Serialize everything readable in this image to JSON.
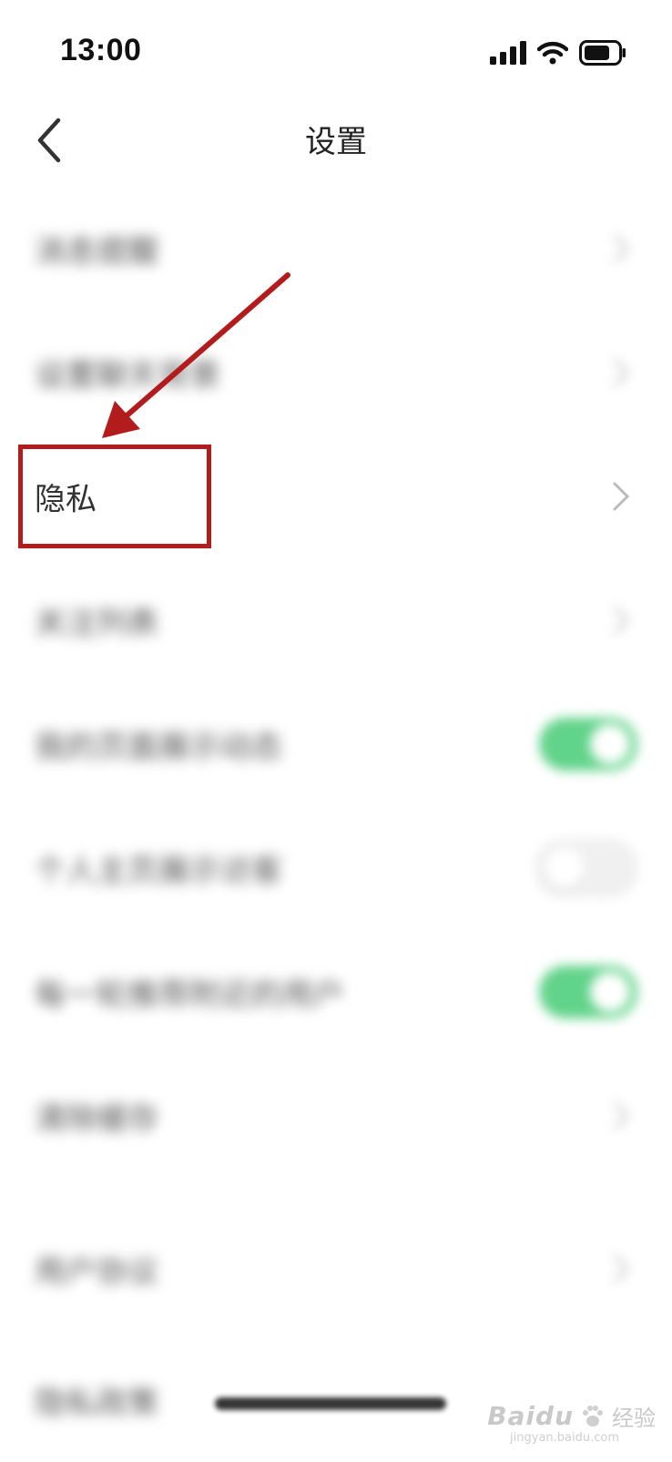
{
  "status_bar": {
    "time": "13:00",
    "icons": [
      "signal-icon",
      "wifi-icon",
      "battery-icon"
    ]
  },
  "nav": {
    "title": "设置",
    "back_icon": "chevron-left-icon"
  },
  "settings": [
    {
      "label": "消息提醒",
      "control": "chevron",
      "blurred": true
    },
    {
      "label": "设置聊天背景",
      "control": "chevron",
      "blurred": true
    },
    {
      "label": "隐私",
      "control": "chevron",
      "blurred": false,
      "highlighted": true
    },
    {
      "label": "关注列表",
      "control": "chevron",
      "blurred": true
    },
    {
      "label": "我的页面展示动态",
      "control": "toggle",
      "on": true,
      "blurred": true
    },
    {
      "label": "个人主页展示访客",
      "control": "toggle",
      "on": false,
      "blurred": true
    },
    {
      "label": "每一轮推荐附近的用户",
      "control": "toggle",
      "on": true,
      "blurred": true
    },
    {
      "label": "清除缓存",
      "control": "chevron",
      "blurred": true
    },
    {
      "label": "用户协议",
      "control": "chevron",
      "blurred": true
    },
    {
      "label": "隐私政策",
      "control": "chevron",
      "blurred": true
    }
  ],
  "colors": {
    "toggle_on": "#62d38a",
    "annotation": "#b21c1c",
    "chevron": "#bbbbbb"
  },
  "watermark": {
    "logo": "Baidu",
    "cn": "经验",
    "url": "jingyan.baidu.com"
  }
}
